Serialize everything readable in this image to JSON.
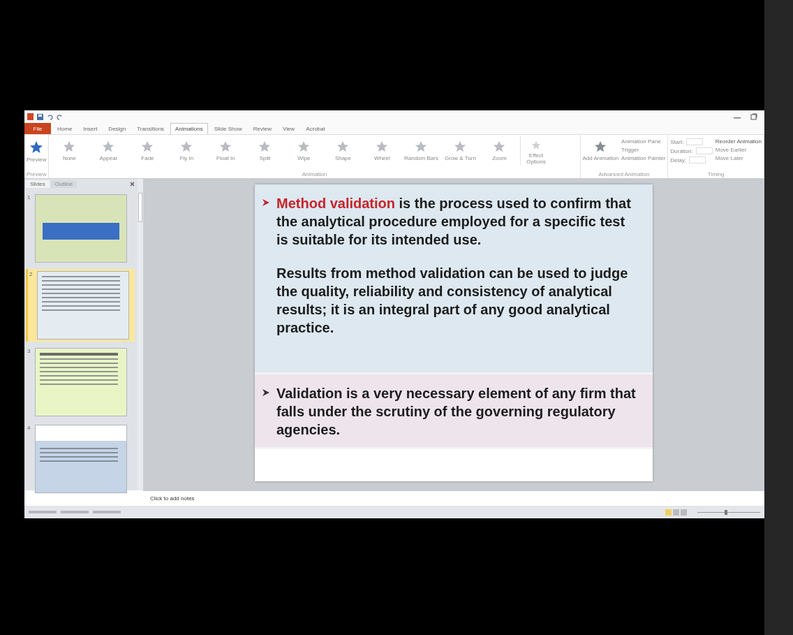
{
  "ribbon": {
    "tabs": [
      {
        "label": "File",
        "selected": false,
        "kind": "file"
      },
      {
        "label": "Home",
        "selected": false,
        "kind": "tab"
      },
      {
        "label": "Insert",
        "selected": false,
        "kind": "tab"
      },
      {
        "label": "Design",
        "selected": false,
        "kind": "tab"
      },
      {
        "label": "Transitions",
        "selected": false,
        "kind": "tab"
      },
      {
        "label": "Animations",
        "selected": true,
        "kind": "tab"
      },
      {
        "label": "Slide Show",
        "selected": false,
        "kind": "tab"
      },
      {
        "label": "Review",
        "selected": false,
        "kind": "tab"
      },
      {
        "label": "View",
        "selected": false,
        "kind": "tab"
      },
      {
        "label": "Acrobat",
        "selected": false,
        "kind": "tab"
      }
    ],
    "preview": "Preview",
    "gallery": [
      "None",
      "Appear",
      "Fade",
      "Fly In",
      "Float In",
      "Split",
      "Wipe",
      "Shape",
      "Wheel",
      "Random Bars",
      "Grow & Turn",
      "Zoom"
    ],
    "effect_options": "Effect Options",
    "add_animation": "Add Animation",
    "advanced": [
      "Animation Pane",
      "Trigger",
      "Animation Painter"
    ],
    "timing": [
      "Start:",
      "Duration:",
      "Delay:"
    ],
    "reorder": {
      "title": "Reorder Animation",
      "items": [
        "Move Earlier",
        "Move Later"
      ]
    },
    "groups": [
      "Preview",
      "Animation",
      "Advanced Animation",
      "Timing"
    ]
  },
  "slides_panel": {
    "tabs": [
      {
        "label": "Slides",
        "selected": true
      },
      {
        "label": "Outline",
        "selected": false
      }
    ],
    "thumbnails": [
      {
        "number": "1",
        "kind": "title",
        "selected": false
      },
      {
        "number": "2",
        "kind": "text",
        "selected": true
      },
      {
        "number": "3",
        "kind": "green",
        "selected": false
      },
      {
        "number": "4",
        "kind": "blue",
        "selected": false
      }
    ]
  },
  "slide": {
    "boxes": [
      {
        "kind": "blue",
        "paragraphs": [
          {
            "bullet": true,
            "highlight": "Method validation",
            "text": " is the process used to confirm that the analytical procedure employed for a specific test is suitable for its intended use."
          },
          {
            "bullet": false,
            "text": "Results from method validation can be used to judge the quality, reliability and consistency of analytical results; it is an integral part of any good analytical practice."
          }
        ]
      },
      {
        "kind": "pink",
        "paragraphs": [
          {
            "bullet": true,
            "text": "Validation is a very necessary element of any firm that falls under the scrutiny of the governing regulatory agencies."
          }
        ]
      }
    ]
  },
  "notes": {
    "placeholder": "Click to add notes"
  },
  "status_bar": {
    "zoom": {
      "level": 0.45
    }
  }
}
